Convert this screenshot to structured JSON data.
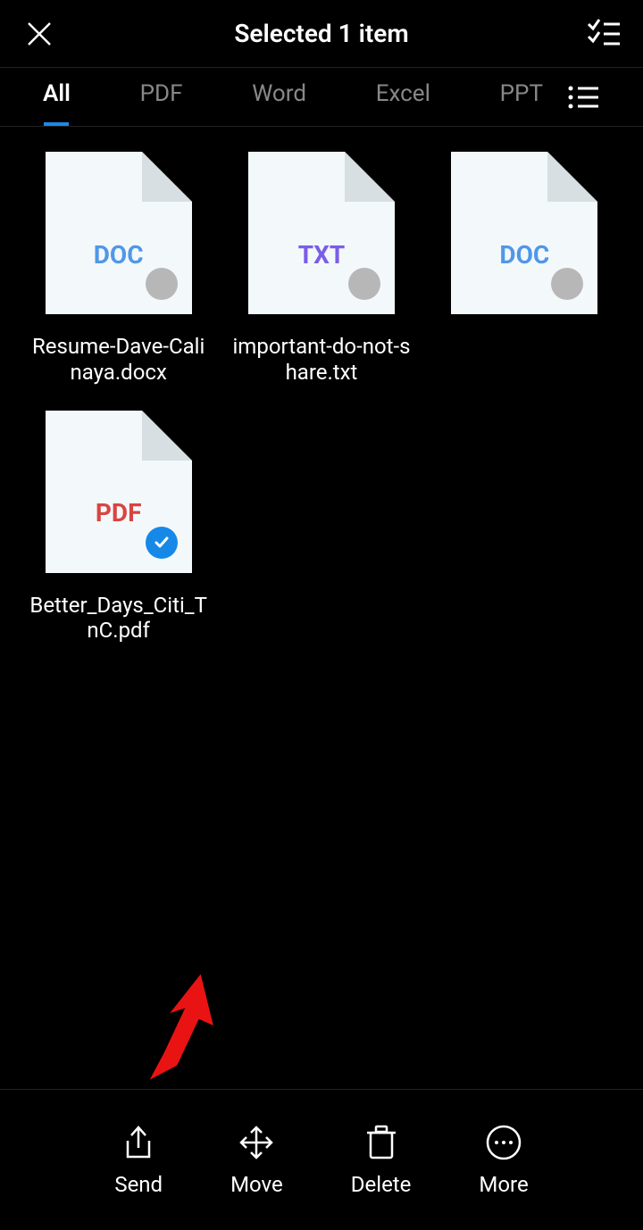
{
  "header": {
    "title": "Selected 1 item"
  },
  "tabs": {
    "items": [
      "All",
      "PDF",
      "Word",
      "Excel",
      "PPT"
    ],
    "activeIndex": 0
  },
  "files": [
    {
      "name": "Resume-Dave-Calinaya.docx",
      "ext": "DOC",
      "extClass": "ext-doc",
      "selected": false
    },
    {
      "name": "important-do-not-share.txt",
      "ext": "TXT",
      "extClass": "ext-txt",
      "selected": false
    },
    {
      "name": "",
      "ext": "DOC",
      "extClass": "ext-doc",
      "selected": false
    },
    {
      "name": "Better_Days_Citi_TnC.pdf",
      "ext": "PDF",
      "extClass": "ext-pdf",
      "selected": true
    }
  ],
  "actions": {
    "send": "Send",
    "move": "Move",
    "delete": "Delete",
    "more": "More"
  }
}
